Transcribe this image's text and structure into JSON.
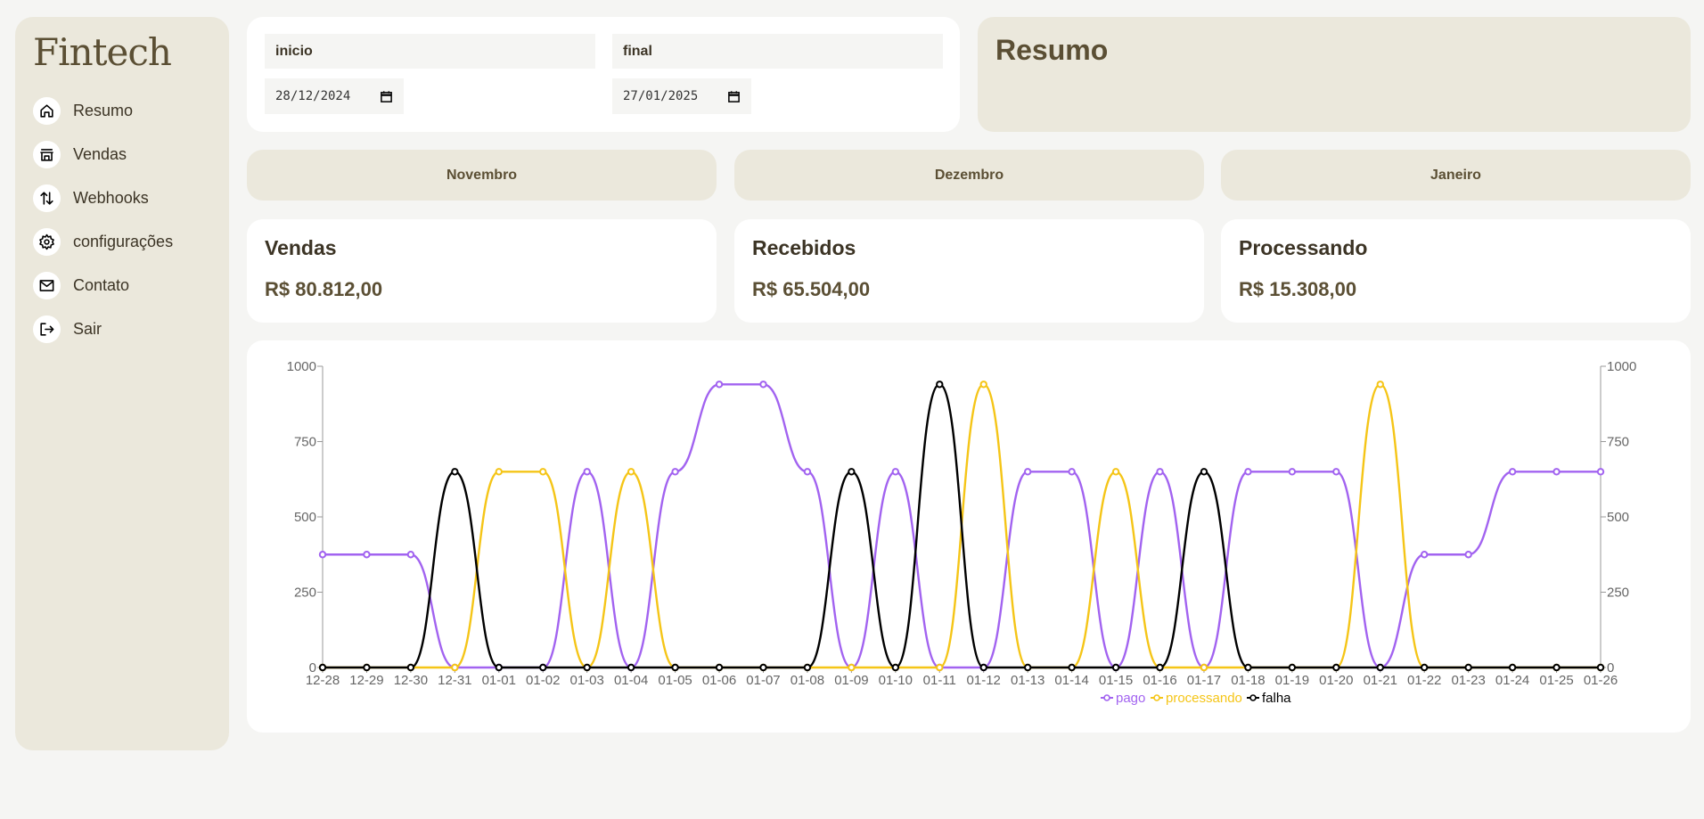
{
  "app": {
    "logo": "Fintech"
  },
  "sidebar": {
    "items": [
      {
        "label": "Resumo",
        "icon": "home-icon"
      },
      {
        "label": "Vendas",
        "icon": "store-icon"
      },
      {
        "label": "Webhooks",
        "icon": "arrows-updown-icon"
      },
      {
        "label": "configurações",
        "icon": "gear-icon"
      },
      {
        "label": "Contato",
        "icon": "mail-icon"
      },
      {
        "label": "Sair",
        "icon": "logout-icon"
      }
    ]
  },
  "filters": {
    "start": {
      "label": "inicio",
      "value": "28/12/2024"
    },
    "end": {
      "label": "final",
      "value": "27/01/2025"
    }
  },
  "summary": {
    "title": "Resumo"
  },
  "months": [
    "Novembro",
    "Dezembro",
    "Janeiro"
  ],
  "stats": [
    {
      "title": "Vendas",
      "value": "R$ 80.812,00"
    },
    {
      "title": "Recebidos",
      "value": "R$ 65.504,00"
    },
    {
      "title": "Processando",
      "value": "R$ 15.308,00"
    }
  ],
  "colors": {
    "pago": "#a263f0",
    "processando": "#f5c517",
    "falha": "#000000",
    "accent": "#5b4f34",
    "panel": "#ebe8dc"
  },
  "chart_data": {
    "type": "line",
    "x": [
      "12-28",
      "12-29",
      "12-30",
      "12-31",
      "01-01",
      "01-02",
      "01-03",
      "01-04",
      "01-05",
      "01-06",
      "01-07",
      "01-08",
      "01-09",
      "01-10",
      "01-11",
      "01-12",
      "01-13",
      "01-14",
      "01-15",
      "01-16",
      "01-17",
      "01-18",
      "01-19",
      "01-20",
      "01-21",
      "01-22",
      "01-23",
      "01-24",
      "01-25",
      "01-26"
    ],
    "ylim": [
      0,
      1000
    ],
    "yticks": [
      0,
      250,
      500,
      750,
      1000
    ],
    "dual_axis": true,
    "legend": "bottom",
    "series": [
      {
        "name": "pago",
        "values": [
          375,
          375,
          375,
          0,
          0,
          0,
          650,
          0,
          650,
          940,
          940,
          650,
          0,
          650,
          0,
          0,
          650,
          650,
          0,
          650,
          0,
          650,
          650,
          650,
          0,
          375,
          375,
          650,
          650,
          650
        ]
      },
      {
        "name": "processando",
        "values": [
          0,
          0,
          0,
          0,
          650,
          650,
          0,
          650,
          0,
          0,
          0,
          0,
          0,
          0,
          0,
          940,
          0,
          0,
          650,
          0,
          0,
          0,
          0,
          0,
          940,
          0,
          0,
          0,
          0,
          0
        ]
      },
      {
        "name": "falha",
        "values": [
          0,
          0,
          0,
          650,
          0,
          0,
          0,
          0,
          0,
          0,
          0,
          0,
          650,
          0,
          940,
          0,
          0,
          0,
          0,
          0,
          650,
          0,
          0,
          0,
          0,
          0,
          0,
          0,
          0,
          0
        ]
      }
    ]
  }
}
